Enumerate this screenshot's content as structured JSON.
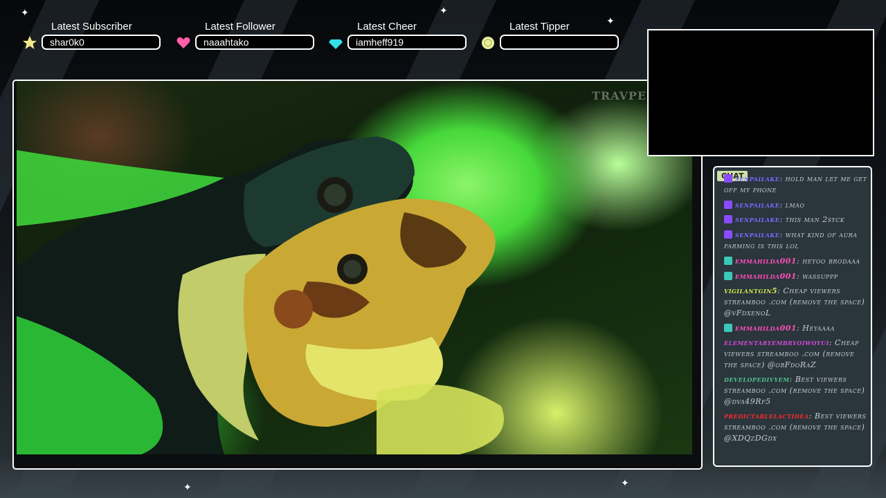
{
  "alerts": {
    "subscriber": {
      "title": "Latest Subscriber",
      "value": "shar0k0",
      "icon": "star-icon",
      "color": "#f4e98a"
    },
    "follower": {
      "title": "Latest Follower",
      "value": "naaahtako",
      "icon": "heart-icon",
      "color": "#ff5fa8"
    },
    "cheer": {
      "title": "Latest Cheer",
      "value": "iamheff919",
      "icon": "gem-icon",
      "color": "#33e0e8"
    },
    "tipper": {
      "title": "Latest Tipper",
      "value": "",
      "icon": "coin-icon",
      "color": "#e8f0a0"
    }
  },
  "video": {
    "watermark": "TRAVPEDIA"
  },
  "chat": {
    "tab_label": "CHAT",
    "messages": [
      {
        "name": "senpailake",
        "text": "hold man let me get off my phone",
        "name_color": "#7a6bff",
        "badge": "purple"
      },
      {
        "name": "senpailake",
        "text": "lmao",
        "name_color": "#7a6bff",
        "badge": "purple"
      },
      {
        "name": "senpailake",
        "text": "this man 2syck",
        "name_color": "#7a6bff",
        "badge": "purple"
      },
      {
        "name": "senpailake",
        "text": "what kind of aura farming is this lol",
        "name_color": "#7a6bff",
        "badge": "purple"
      },
      {
        "name": "emmahilda001",
        "text": "heyoo brodaaa",
        "name_color": "#ff4fb8",
        "badge": "teal"
      },
      {
        "name": "emmahilda001",
        "text": "wassuppp",
        "name_color": "#ff4fb8",
        "badge": "teal"
      },
      {
        "name": "vigilantgin5",
        "text": "Cheap viewers streamboo .com (remove the space) @vFdxenoL",
        "name_color": "#d6e84a",
        "badge": ""
      },
      {
        "name": "emmahilda001",
        "text": "Heyaaaa",
        "name_color": "#ff4fb8",
        "badge": "teal"
      },
      {
        "name": "elementaryembryoiwoyui",
        "text": "Cheap viewers streamboo .com (remove the space) @obFdoRaZ",
        "name_color": "#d24ad8",
        "badge": ""
      },
      {
        "name": "developedivyem",
        "text": "Best viewers streamboo .com (remove the space) @dva49Rf5",
        "name_color": "#54c08c",
        "badge": ""
      },
      {
        "name": "predictablelactidea",
        "text": "Best viewers streamboo .com (remove the space) @XDQzDGdx",
        "name_color": "#ff2a2a",
        "badge": ""
      }
    ]
  }
}
